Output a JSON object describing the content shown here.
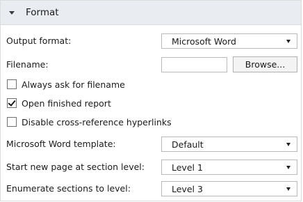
{
  "section": {
    "title": "Format",
    "expanded": true
  },
  "output_format": {
    "label": "Output format:",
    "value": "Microsoft Word"
  },
  "filename": {
    "label": "Filename:",
    "value": "",
    "browse_label": "Browse..."
  },
  "checkboxes": {
    "always_ask": {
      "label": "Always ask for filename",
      "checked": false
    },
    "open_finished": {
      "label": "Open finished report",
      "checked": true
    },
    "disable_xref": {
      "label": "Disable cross-reference hyperlinks",
      "checked": false
    }
  },
  "word_template": {
    "label": "Microsoft Word template:",
    "value": "Default"
  },
  "new_page_level": {
    "label": "Start new page at section level:",
    "value": "Level 1"
  },
  "enumerate_level": {
    "label": "Enumerate sections to level:",
    "value": "Level 3"
  },
  "icons": {
    "section_toggle": "chevron-down-icon",
    "dropdown": "dropdown-arrow-icon",
    "check": "checkmark-icon"
  }
}
